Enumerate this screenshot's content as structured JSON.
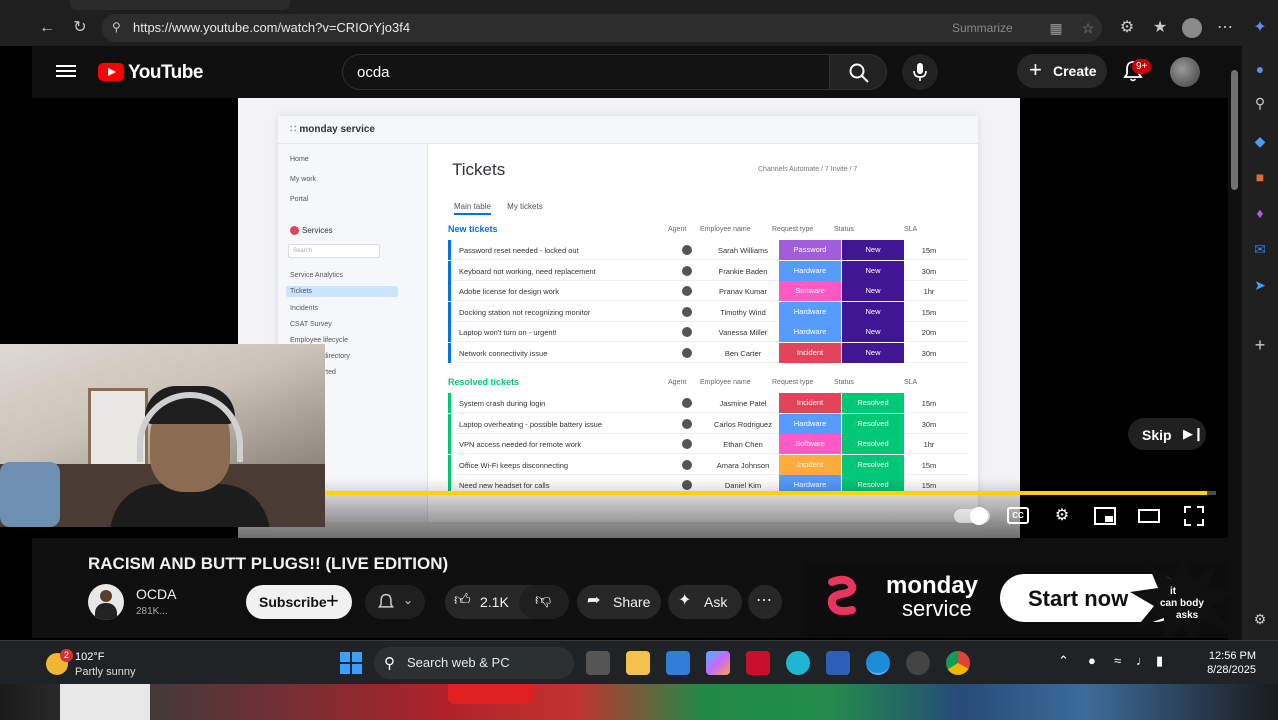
{
  "browser": {
    "url": "https://www.youtube.com/watch?v=CRIOrYjo3f4",
    "summarize_label": "Summarize"
  },
  "youtube": {
    "logo_text": "YouTube",
    "search_query": "ocda",
    "create_label": "Create",
    "notification_count": "9+"
  },
  "player": {
    "skip_label": "Skip",
    "progress_fraction": 0.99,
    "cc_label": "CC"
  },
  "monday_app": {
    "brand": "monday service",
    "page_title": "Tickets",
    "sidebar": {
      "items": [
        "Home",
        "My work",
        "Portal"
      ],
      "workspace": "Services",
      "search_placeholder": "Search",
      "sub_items": [
        "Service Analytics",
        "Tickets",
        "Incidents",
        "CSAT Survey",
        "Employee lifecycle",
        "Employee directory",
        "Getting started"
      ]
    },
    "toolbar": "Channels   Automate / 7   Invite / 7",
    "tabs": [
      "Main table",
      "My tickets"
    ],
    "columns": [
      "Agent",
      "Employee name",
      "Request type",
      "Status",
      "SLA"
    ],
    "groups": [
      {
        "title": "New tickets",
        "color": "#0073ea",
        "rows": [
          {
            "name": "Password reset needed - locked out",
            "employee": "Sarah Williams",
            "request": "Password",
            "request_color": "#a25ddc",
            "status": "New",
            "status_color": "#401694",
            "sla": "15m"
          },
          {
            "name": "Keyboard not working, need replacement",
            "employee": "Frankie Baden",
            "request": "Hardware",
            "request_color": "#579bfc",
            "status": "New",
            "status_color": "#401694",
            "sla": "30m"
          },
          {
            "name": "Adobe license for design work",
            "employee": "Pranav Kumar",
            "request": "Software",
            "request_color": "#ff5ac4",
            "status": "New",
            "status_color": "#401694",
            "sla": "1hr"
          },
          {
            "name": "Docking station not recognizing monitor",
            "employee": "Timothy Wind",
            "request": "Hardware",
            "request_color": "#579bfc",
            "status": "New",
            "status_color": "#401694",
            "sla": "15m"
          },
          {
            "name": "Laptop won't turn on - urgent!",
            "employee": "Vanessa Miller",
            "request": "Hardware",
            "request_color": "#579bfc",
            "status": "New",
            "status_color": "#401694",
            "sla": "20m"
          },
          {
            "name": "Network connectivity issue",
            "employee": "Ben Carter",
            "request": "Incident",
            "request_color": "#e2445c",
            "status": "New",
            "status_color": "#401694",
            "sla": "30m"
          }
        ]
      },
      {
        "title": "Resolved tickets",
        "color": "#00c875",
        "rows": [
          {
            "name": "System crash during login",
            "employee": "Jasmine Patel",
            "request": "Incident",
            "request_color": "#e2445c",
            "status": "Resolved",
            "status_color": "#00c875",
            "sla": "15m"
          },
          {
            "name": "Laptop overheating - possible battery issue",
            "employee": "Carlos Rodriguez",
            "request": "Hardware",
            "request_color": "#579bfc",
            "status": "Resolved",
            "status_color": "#00c875",
            "sla": "30m"
          },
          {
            "name": "VPN access needed for remote work",
            "employee": "Ethan Chen",
            "request": "Software",
            "request_color": "#ff5ac4",
            "status": "Resolved",
            "status_color": "#00c875",
            "sla": "1hr"
          },
          {
            "name": "Office Wi-Fi keeps disconnecting",
            "employee": "Amara Johnson",
            "request": "Incident",
            "request_color": "#fdab3d",
            "status": "Resolved",
            "status_color": "#00c875",
            "sla": "15m"
          },
          {
            "name": "Need new headset for calls",
            "employee": "Daniel Kim",
            "request": "Hardware",
            "request_color": "#579bfc",
            "status": "Resolved",
            "status_color": "#00c875",
            "sla": "15m"
          }
        ]
      }
    ]
  },
  "video": {
    "title": "RACISM AND BUTT PLUGS!! (LIVE EDITION)",
    "channel_name": "OCDA",
    "subscribers": "281K...",
    "subscribe_label": "Subscribe",
    "likes": "2.1K",
    "share_label": "Share",
    "ask_label": "Ask"
  },
  "ad": {
    "brand_line1": "monday",
    "brand_line2": "service",
    "cta": "Start now",
    "overlay_text": "it can body asks"
  },
  "taskbar": {
    "weather_badge": "2",
    "temperature": "102°F",
    "condition": "Partly sunny",
    "search_label": "Search web & PC",
    "time": "12:56 PM",
    "date": "8/28/2025"
  },
  "colors": {
    "youtube_red": "#ff0000",
    "progress": "#ffd400"
  }
}
